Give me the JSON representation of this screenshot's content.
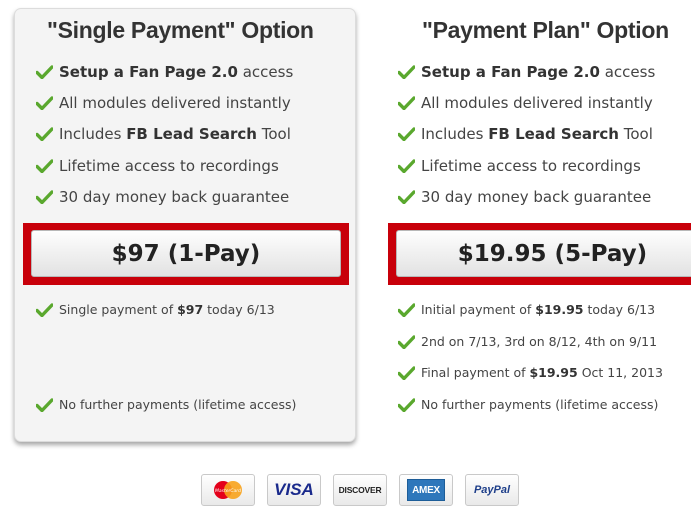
{
  "plans": [
    {
      "title": "\"Single Payment\" Option",
      "features": [
        {
          "pre": "",
          "bold": "Setup a Fan Page 2.0",
          "post": " access"
        },
        {
          "pre": "All modules delivered instantly",
          "bold": "",
          "post": ""
        },
        {
          "pre": "Includes ",
          "bold": "FB Lead Search",
          "post": " Tool"
        },
        {
          "pre": "Lifetime access to recordings",
          "bold": "",
          "post": ""
        },
        {
          "pre": "30 day money back guarantee",
          "bold": "",
          "post": ""
        }
      ],
      "button_label": "$97 (1-Pay)",
      "details": [
        {
          "pre": "Single payment of ",
          "bold": "$97",
          "post": " today 6/13"
        },
        {
          "pre": "No further payments (lifetime access)",
          "bold": "",
          "post": ""
        }
      ]
    },
    {
      "title": "\"Payment Plan\" Option",
      "features": [
        {
          "pre": "",
          "bold": "Setup a Fan Page 2.0",
          "post": " access"
        },
        {
          "pre": "All modules delivered instantly",
          "bold": "",
          "post": ""
        },
        {
          "pre": "Includes ",
          "bold": "FB Lead Search",
          "post": " Tool"
        },
        {
          "pre": "Lifetime access to recordings",
          "bold": "",
          "post": ""
        },
        {
          "pre": "30 day money back guarantee",
          "bold": "",
          "post": ""
        }
      ],
      "button_label": "$19.95 (5-Pay)",
      "details": [
        {
          "pre": "Initial payment of ",
          "bold": "$19.95",
          "post": " today 6/13"
        },
        {
          "pre": "2nd on 7/13, 3rd on 8/12, 4th on 9/11",
          "bold": "",
          "post": ""
        },
        {
          "pre": "Final payment of ",
          "bold": "$19.95",
          "post": " Oct 11, 2013"
        },
        {
          "pre": "No further payments (lifetime access)",
          "bold": "",
          "post": ""
        }
      ]
    }
  ],
  "payment_logos": {
    "mastercard": "MasterCard",
    "visa": "VISA",
    "discover": "DISCOVER",
    "amex": "AMEX",
    "paypal": "PayPal"
  },
  "colors": {
    "check_green": "#5aa82e",
    "button_border_red": "#c8000a",
    "card_background": "#f4f4f4"
  }
}
